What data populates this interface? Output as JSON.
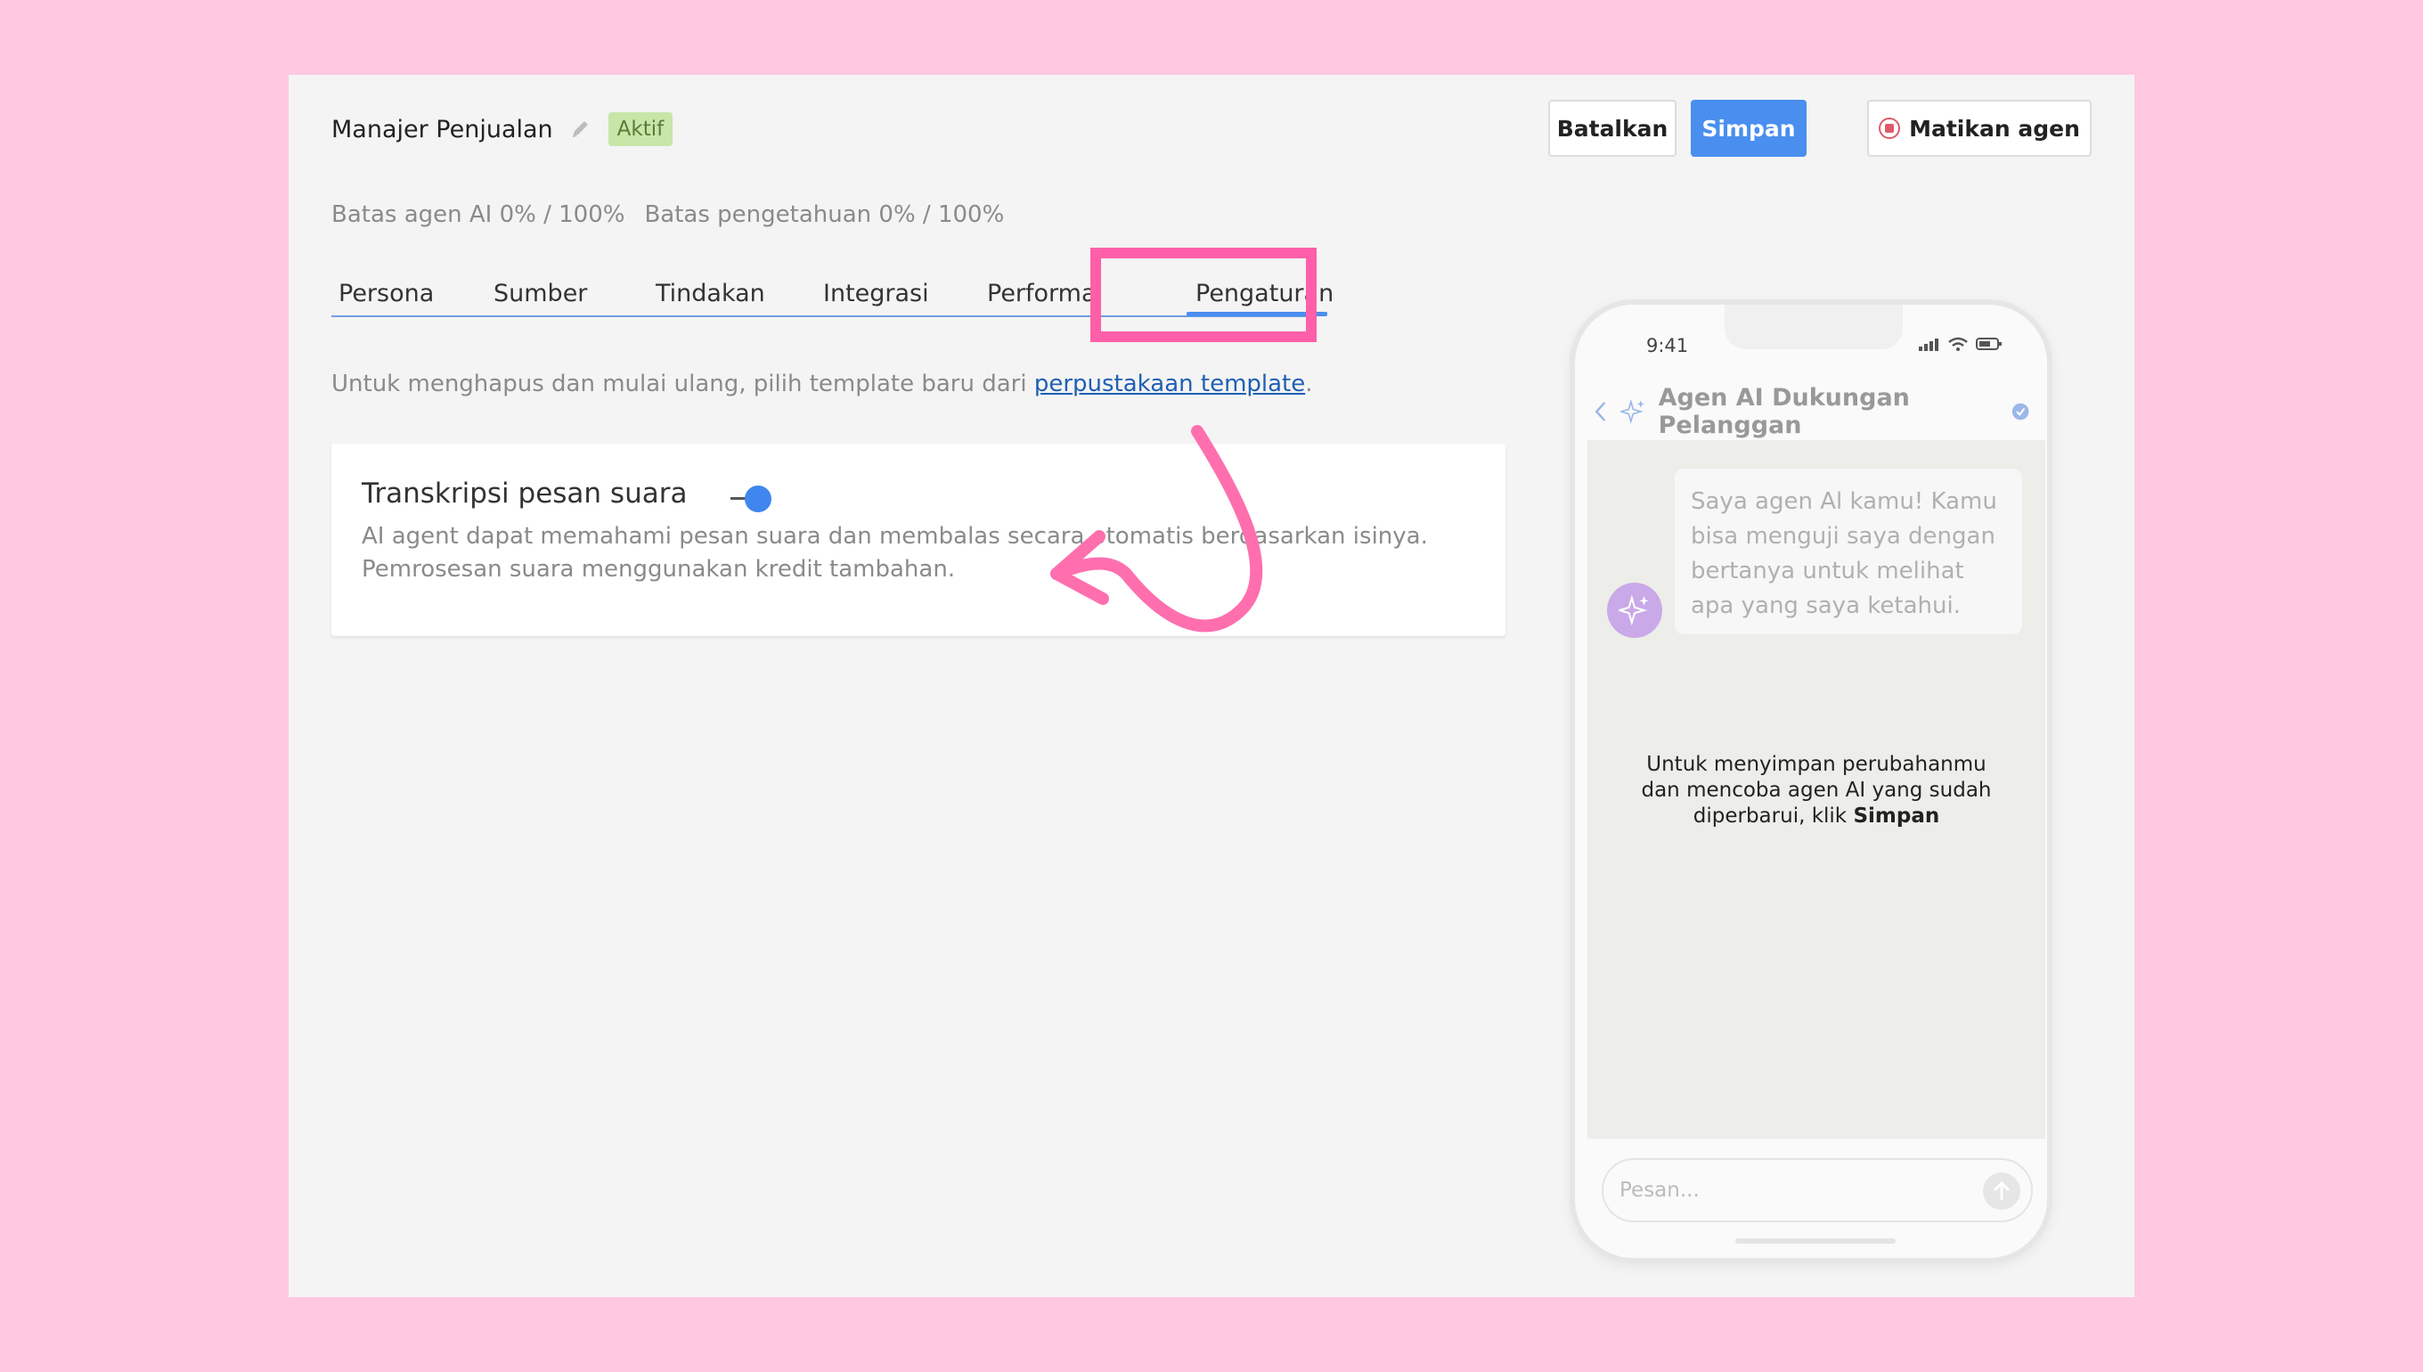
{
  "header": {
    "agent_name": "Manajer Penjualan",
    "status_badge": "Aktif",
    "cancel_label": "Batalkan",
    "save_label": "Simpan",
    "stop_label": "Matikan agen"
  },
  "limits": {
    "ai_agent": "Batas agen AI 0% / 100%",
    "knowledge": "Batas pengetahuan 0% / 100%"
  },
  "tabs": [
    {
      "label": "Persona"
    },
    {
      "label": "Sumber"
    },
    {
      "label": "Tindakan"
    },
    {
      "label": "Integrasi"
    },
    {
      "label": "Performa"
    },
    {
      "label": "Pengaturan"
    }
  ],
  "active_tab": "Pengaturan",
  "template_notice": {
    "text": "Untuk menghapus dan mulai ulang, pilih template baru dari ",
    "link": "perpustakaan template",
    "suffix": "."
  },
  "voice_setting": {
    "title": "Transkripsi pesan suara",
    "enabled": true,
    "desc_line1": "AI agent dapat memahami pesan suara dan membalas secara otomatis berdasarkan isinya.",
    "desc_line2": "Pemrosesan suara menggunakan kredit tambahan."
  },
  "preview": {
    "time": "9:41",
    "chat_title": "Agen AI Dukungan Pelanggan",
    "bot_message": "Saya agen Al kamu! Kamu bisa menguji saya dengan bertanya untuk melihat apa yang saya ketahui.",
    "hint_line1": "Untuk menyimpan perubahanmu",
    "hint_line2": "dan mencoba agen AI yang sudah",
    "hint_prefix": "diperbarui, klik ",
    "hint_bold": "Simpan",
    "input_placeholder": "Pesan..."
  },
  "colors": {
    "background": "#ffc8e0",
    "accent": "#4a8ef0",
    "annotation": "#ff5fa8",
    "active_badge": "#c8e6a8"
  }
}
